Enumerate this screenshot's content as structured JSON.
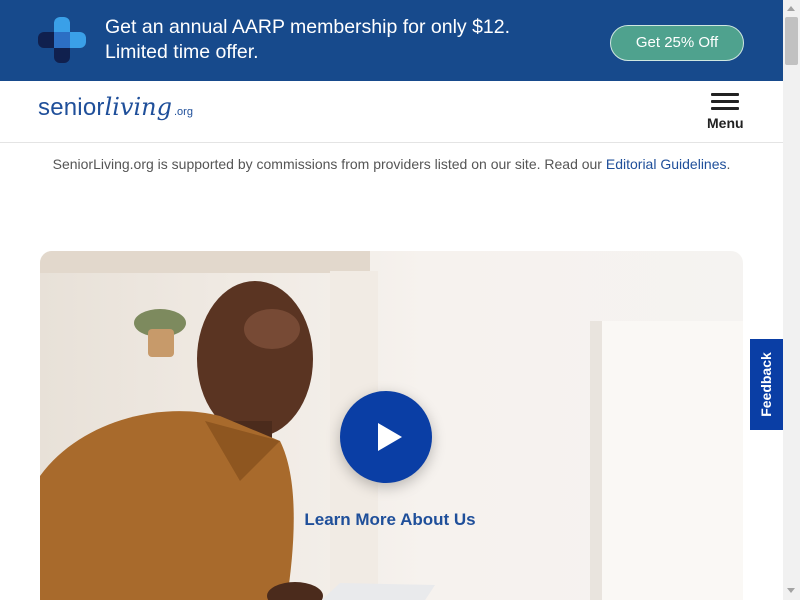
{
  "promo": {
    "line1": "Get an annual AARP membership for only $12.",
    "line2": "Limited time offer.",
    "cta": "Get 25% Off",
    "logo_icon": "plus-cross-icon",
    "colors": {
      "background": "#174a8c",
      "cta": "#4fa28e"
    }
  },
  "header": {
    "brand_prefix": "senior",
    "brand_script": "living",
    "brand_suffix": ".org",
    "menu_label": "Menu",
    "menu_icon": "hamburger-icon"
  },
  "disclaimer": {
    "text": "SeniorLiving.org is supported by commissions from providers listed on our site. Read our ",
    "link": "Editorial Guidelines",
    "end": "."
  },
  "hero": {
    "learn_more": "Learn More About Us",
    "play_icon": "play-icon",
    "accent": "#0a3ea5"
  },
  "feedback": {
    "label": "Feedback"
  }
}
